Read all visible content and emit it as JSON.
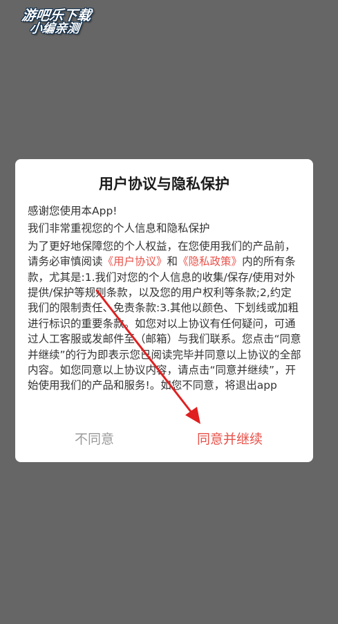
{
  "watermark": {
    "line1": "游吧乐下载",
    "line2": "小编亲测"
  },
  "dialog": {
    "title": "用户协议与隐私保护",
    "para1": "感谢您使用本App!",
    "para2": "我们非常重视您的个人信息和隐私保护",
    "para3_before": "为了更好地保障您的个人权益，在您使用我们的产品前，请务必审慎阅读",
    "user_agreement_link": "《用户协议》",
    "and_text": "和",
    "privacy_policy_link": "《隐私政策》",
    "para3_after": "内的所有条款，尤其是:1.我们对您的个人信息的收集/保存/使用对外提供/保护等规则条款，以及您的用户权利等条款;2,约定我们的限制责任、免责条款:3.其他以颜色、下划线或加粗进行标识的重要条款。如您对以上协议有任何疑问，可通过人工客服或发邮件至（邮箱）与我们联系。您点击“同意并继续”的行为即表示您已阅读完毕并同意以上协议的全部内容。如您同意以上协议内容，请点击“同意并继续”，开始使用我们的产品和服务!。如您不同意，将退出app",
    "disagree_label": "不同意",
    "agree_label": "同意并继续"
  },
  "colors": {
    "overlay": "#666666",
    "accent": "#e8524a",
    "arrow": "#e02020"
  }
}
